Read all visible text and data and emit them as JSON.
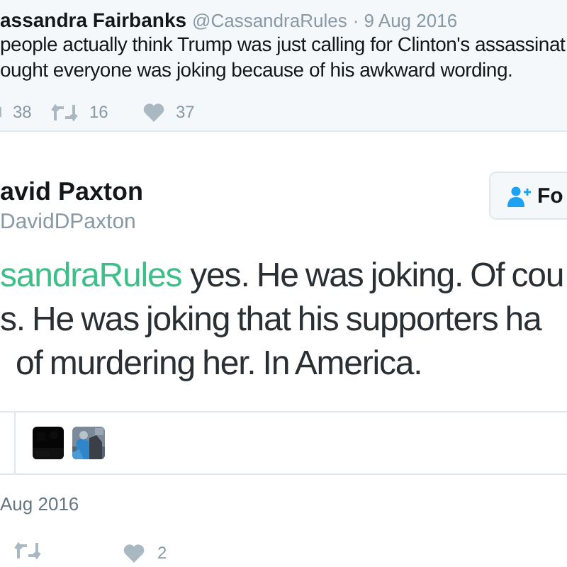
{
  "context_tweet": {
    "name": "assandra Fairbanks",
    "handle": "@CassandraRules",
    "date": "· 9 Aug 2016",
    "lines": [
      "people actually think Trump was just calling for Clinton's assassinat",
      "ought everyone was joking because of his awkward wording."
    ],
    "replies": "38",
    "retweets": "16",
    "likes": "37"
  },
  "tweet": {
    "name": "avid Paxton",
    "handle": "DavidDPaxton",
    "follow_button": "Fo",
    "mention": "sandraRules",
    "lines": [
      "yes. He was joking. Of cou",
      "s. He was joking that his supporters ha",
      "of murdering her. In America."
    ],
    "date": "Aug 2016",
    "likes": "2"
  }
}
